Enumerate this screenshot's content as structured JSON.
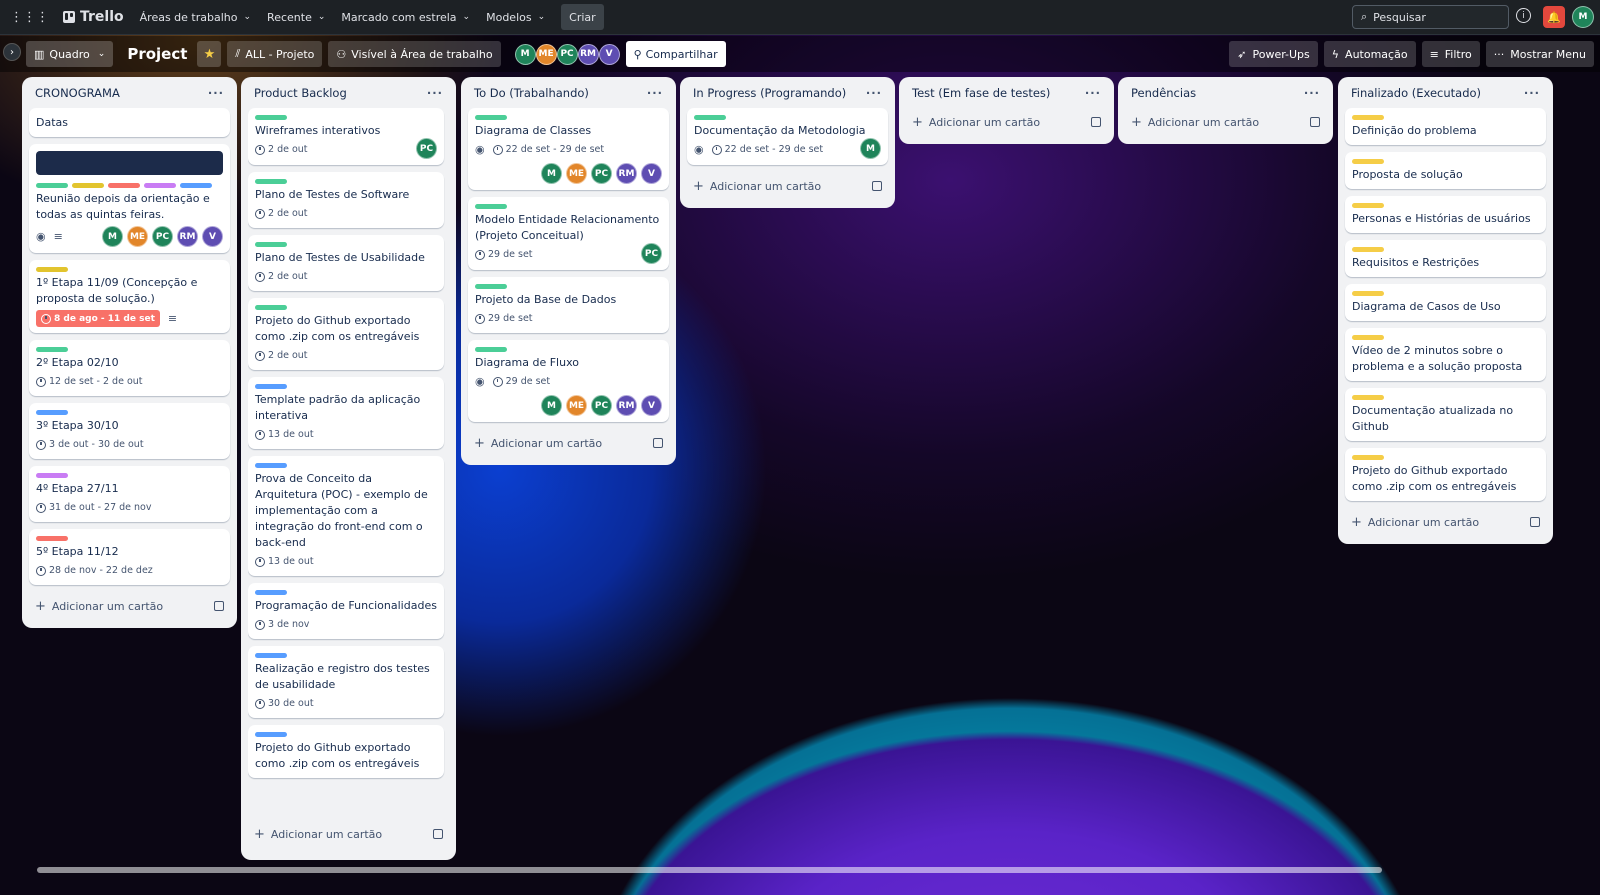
{
  "topbar": {
    "brand": "Trello",
    "menus": [
      "Áreas de trabalho",
      "Recente",
      "Marcado com estrela",
      "Modelos"
    ],
    "create": "Criar",
    "search_placeholder": "Pesquisar",
    "profile": "M"
  },
  "boardbar": {
    "view": "Quadro",
    "title": "Project",
    "workspace": "ALL - Projeto",
    "visibility": "Visível à Área de trabalho",
    "share": "Compartilhar",
    "powerups": "Power-Ups",
    "automation": "Automação",
    "filter": "Filtro",
    "menu": "Mostrar Menu",
    "members": [
      "M",
      "ME",
      "PC",
      "RM",
      "V"
    ]
  },
  "add_card": "Adicionar um cartão",
  "lists": [
    {
      "title": "CRONOGRAMA",
      "cards": [
        {
          "title": "Datas"
        },
        {
          "cover": true,
          "labels": [
            "green",
            "yellow",
            "red",
            "purple",
            "blue"
          ],
          "title": "Reunião depois da orientação e todas as quintas feiras.",
          "members": [
            "M",
            "ME",
            "PC",
            "RM",
            "V"
          ]
        },
        {
          "labels": [
            "yellow"
          ],
          "title": "1º Etapa 11/09 (Concepção e proposta de solução.)",
          "badge": "8 de ago - 11 de set"
        },
        {
          "labels": [
            "green"
          ],
          "title": "2º Etapa 02/10",
          "date": "12 de set - 2 de out"
        },
        {
          "labels": [
            "blue"
          ],
          "title": "3º Etapa 30/10",
          "date": "3 de out - 30 de out"
        },
        {
          "labels": [
            "purple"
          ],
          "title": "4º Etapa 27/11",
          "date": "31 de out - 27 de nov"
        },
        {
          "labels": [
            "red"
          ],
          "title": "5º Etapa 11/12",
          "date": "28 de nov - 22 de dez"
        }
      ]
    },
    {
      "title": "Product Backlog",
      "cards": [
        {
          "labels": [
            "green"
          ],
          "title": "Wireframes interativos",
          "date": "2 de out",
          "members": [
            "PC"
          ]
        },
        {
          "labels": [
            "green"
          ],
          "title": "Plano de Testes de Software",
          "date": "2 de out"
        },
        {
          "labels": [
            "green"
          ],
          "title": "Plano de Testes de Usabilidade",
          "date": "2 de out"
        },
        {
          "labels": [
            "green"
          ],
          "title": "Projeto do Github exportado como .zip com os entregáveis",
          "date": "2 de out"
        },
        {
          "labels": [
            "blue"
          ],
          "title": "Template padrão da aplicação interativa",
          "date": "13 de out"
        },
        {
          "labels": [
            "blue"
          ],
          "title": "Prova de Conceito da Arquitetura (POC) - exemplo de implementação com a integração do front-end com o back-end",
          "date": "13 de out"
        },
        {
          "labels": [
            "blue"
          ],
          "title": "Programação de Funcionalidades",
          "date": "3 de nov"
        },
        {
          "labels": [
            "blue"
          ],
          "title": "Realização e registro dos testes de usabilidade",
          "date": "30 de out"
        },
        {
          "labels": [
            "blue"
          ],
          "title": "Projeto do Github exportado como .zip com os entregáveis"
        }
      ]
    },
    {
      "title": "To Do (Trabalhando)",
      "cards": [
        {
          "labels": [
            "green"
          ],
          "title": "Diagrama de Classes",
          "date": "22 de set - 29 de set",
          "watch": true,
          "members": [
            "M",
            "ME",
            "PC",
            "RM",
            "V"
          ]
        },
        {
          "labels": [
            "green"
          ],
          "title": "Modelo Entidade Relacionamento (Projeto Conceitual)",
          "date": "29 de set",
          "members": [
            "PC"
          ]
        },
        {
          "labels": [
            "green"
          ],
          "title": "Projeto da Base de Dados",
          "date": "29 de set"
        },
        {
          "labels": [
            "green"
          ],
          "title": "Diagrama de Fluxo",
          "date": "29 de set",
          "watch": true,
          "members": [
            "M",
            "ME",
            "PC",
            "RM",
            "V"
          ]
        }
      ]
    },
    {
      "title": "In Progress (Programando)",
      "cards": [
        {
          "labels": [
            "green"
          ],
          "title": "Documentação da Metodologia",
          "date": "22 de set - 29 de set",
          "watch": true,
          "members": [
            "M"
          ]
        }
      ]
    },
    {
      "title": "Test (Em fase de testes)",
      "cards": []
    },
    {
      "title": "Pendências",
      "cards": []
    },
    {
      "title": "Finalizado (Executado)",
      "cards": [
        {
          "labels": [
            "yellow"
          ],
          "title": "Definição do problema"
        },
        {
          "labels": [
            "yellow"
          ],
          "title": "Proposta de solução"
        },
        {
          "labels": [
            "yellow"
          ],
          "title": "Personas e Histórias de usuários"
        },
        {
          "labels": [
            "yellow"
          ],
          "title": "Requisitos e Restrições"
        },
        {
          "labels": [
            "yellow"
          ],
          "title": "Diagrama de Casos de Uso"
        },
        {
          "labels": [
            "yellow"
          ],
          "title": "Vídeo de 2 minutos sobre o problema e a solução proposta"
        },
        {
          "labels": [
            "yellow"
          ],
          "title": "Documentação atualizada no Github"
        },
        {
          "labels": [
            "yellow"
          ],
          "title": "Projeto do Github exportado como .zip com os entregáveis"
        }
      ]
    }
  ]
}
